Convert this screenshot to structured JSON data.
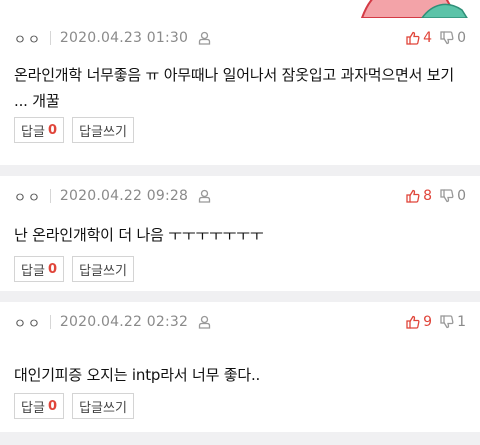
{
  "comments": [
    {
      "author": "ㅇㅇ",
      "date": "2020.04.23 01:30",
      "upvotes": "4",
      "downvotes": "0",
      "text": "온라인개학 너무좋음 ㅠ 아무때나 일어나서 잠옷입고 과자먹으면서 보기 ... 개꿀",
      "reply_label": "답글",
      "reply_count": "0",
      "write_reply_label": "답글쓰기"
    },
    {
      "author": "ㅇㅇ",
      "date": "2020.04.22 09:28",
      "upvotes": "8",
      "downvotes": "0",
      "text": "난 온라인개학이 더 나음 ㅜㅜㅜㅜㅜㅜㅜ",
      "reply_label": "답글",
      "reply_count": "0",
      "write_reply_label": "답글쓰기"
    },
    {
      "author": "ㅇㅇ",
      "date": "2020.04.22 02:32",
      "upvotes": "9",
      "downvotes": "1",
      "text": "대인기피증 오지는 intp라서 너무 좋다..",
      "reply_label": "답글",
      "reply_count": "0",
      "write_reply_label": "답글쓰기"
    }
  ],
  "icons": {
    "upvote": "thumbs-up-icon",
    "downvote": "thumbs-down-icon",
    "person": "person-icon"
  },
  "colors": {
    "upvote": "#e0453a",
    "reply_count": "#e0453a",
    "divider": "#f0f0f2"
  }
}
